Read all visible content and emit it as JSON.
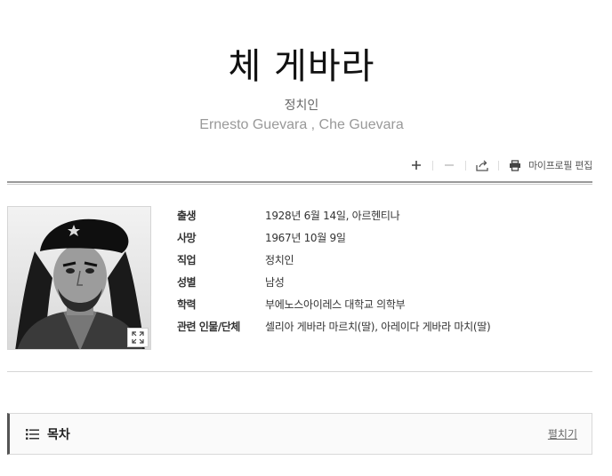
{
  "header": {
    "title": "체 게바라",
    "subtitle": "정치인",
    "alt_name": "Ernesto Guevara , Che Guevara"
  },
  "toolbar": {
    "icons": [
      "plus-icon",
      "minus-icon",
      "share-icon",
      "print-icon"
    ],
    "profile_edit_label": "마이프로필 편집"
  },
  "profile": {
    "rows": [
      {
        "key": "출생",
        "value": "1928년 6월 14일, 아르헨티나"
      },
      {
        "key": "사망",
        "value": "1967년 10월 9일"
      },
      {
        "key": "직업",
        "value": "정치인"
      },
      {
        "key": "성별",
        "value": "남성"
      },
      {
        "key": "학력",
        "value": "부에노스아이레스 대학교 의학부"
      },
      {
        "key": "관련 인물/단체",
        "value": "셀리아 게바라 마르치(딸), 아레이다 게바라 마치(딸)"
      }
    ]
  },
  "toc": {
    "title": "목차",
    "expand_label": "펼치기"
  }
}
